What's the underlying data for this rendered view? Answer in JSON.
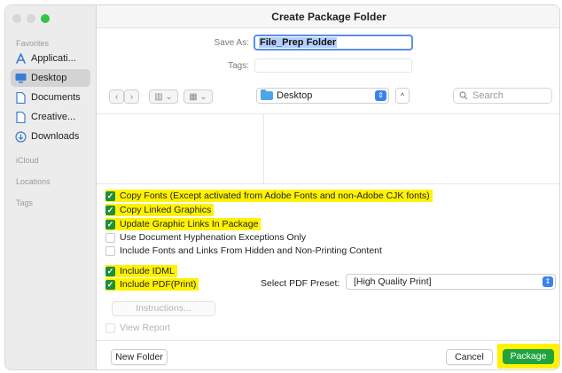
{
  "window": {
    "title": "Create Package Folder"
  },
  "sidebar": {
    "favorites_label": "Favorites",
    "items": [
      {
        "label": "Applicati...",
        "icon": "applications-icon"
      },
      {
        "label": "Desktop",
        "icon": "desktop-icon",
        "active": true
      },
      {
        "label": "Documents",
        "icon": "document-icon"
      },
      {
        "label": "Creative...",
        "icon": "document-icon"
      },
      {
        "label": "Downloads",
        "icon": "downloads-icon"
      }
    ],
    "icloud_label": "iCloud",
    "locations_label": "Locations",
    "tags_label": "Tags"
  },
  "form": {
    "save_as_label": "Save As:",
    "save_as_value": "File_Prep Folder",
    "tags_label": "Tags:",
    "tags_value": ""
  },
  "browser": {
    "location": "Desktop",
    "search_placeholder": "Search",
    "back_glyph": "‹",
    "forward_glyph": "›",
    "view_glyph": "▥ ⌄",
    "group_glyph": "▦ ⌄",
    "up_glyph": "^"
  },
  "options": [
    {
      "label": "Copy Fonts (Except activated from Adobe Fonts and non-Adobe CJK fonts)",
      "checked": true,
      "highlighted": true
    },
    {
      "label": "Copy Linked Graphics",
      "checked": true,
      "highlighted": true
    },
    {
      "label": "Update Graphic Links In Package",
      "checked": true,
      "highlighted": true
    },
    {
      "label": "Use Document Hyphenation Exceptions Only",
      "checked": false,
      "highlighted": false
    },
    {
      "label": "Include Fonts and Links From Hidden and Non-Printing Content",
      "checked": false,
      "highlighted": false
    },
    {
      "label": "Include IDML",
      "checked": true,
      "highlighted": true
    },
    {
      "label": "Include PDF(Print)",
      "checked": true,
      "highlighted": true
    }
  ],
  "pdf_preset": {
    "label": "Select PDF Preset:",
    "value": "[High Quality Print]"
  },
  "instructions_label": "Instructions...",
  "view_report_label": "View Report",
  "buttons": {
    "new_folder": "New Folder",
    "cancel": "Cancel",
    "package": "Package"
  },
  "colors": {
    "highlight": "#fff200",
    "checkbox_checked": "#1f8f3a",
    "primary_button": "#21a340",
    "select_accent": "#3b82f0"
  }
}
